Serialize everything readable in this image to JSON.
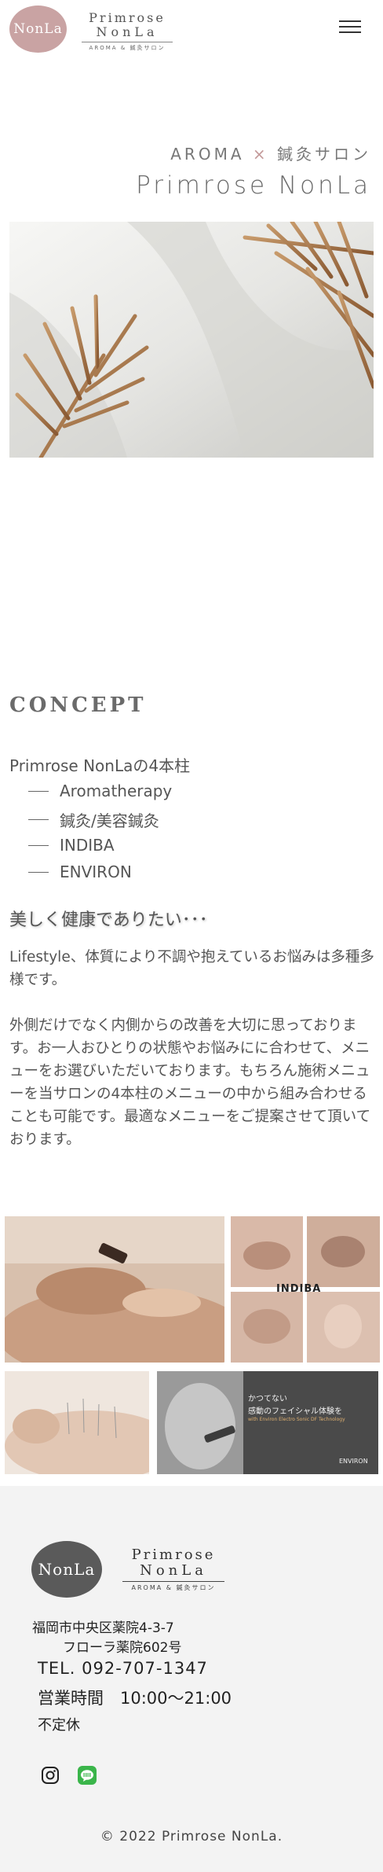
{
  "header": {
    "logo_circle_text": "NonLa",
    "logo_line1": "Primrose",
    "logo_line2": "NonLa",
    "logo_line3": "AROMA & 鍼灸サロン"
  },
  "hero": {
    "subtitle_left": "AROMA",
    "subtitle_x": "×",
    "subtitle_right": "鍼灸サロン",
    "title": "Primrose NonLa"
  },
  "concept": {
    "heading": "CONCEPT",
    "pillars_title": "Primrose NonLaの4本柱",
    "pillars": [
      "Aromatherapy",
      "鍼灸/美容鍼灸",
      "INDIBA",
      "ENVIRON"
    ],
    "lead": "美しく健康でありたい･･･",
    "paragraph1": "Lifestyle、体質により不調や抱えているお悩みは多種多様です。",
    "paragraph2": "外側だけでなく内側からの改善を大切に思っております。お一人おひとりの状態やお悩みにに合わせて、メニューをお選びいただいております。もちろん施術メニューを当サロンの4本柱のメニューの中から組み合わせることも可能です。最適なメニューをご提案させて頂いております。"
  },
  "photos": {
    "indiba_label": "INDIBA",
    "environ_caption1": "かつてない",
    "environ_caption2": "感動のフェイシャル体験を",
    "environ_caption3": "with Environ Electro Sonic DF Technology",
    "environ_brand": "ENVIRON"
  },
  "footer": {
    "logo_circle_text": "NonLa",
    "logo_line1": "Primrose",
    "logo_line2": "NonLa",
    "logo_line3": "AROMA & 鍼灸サロン",
    "address1": "福岡市中央区薬院4-3-7",
    "address2": "フローラ薬院602号",
    "tel": "TEL. 092-707-1347",
    "hours": "営業時間　10:00～21:00",
    "closed": "不定休",
    "copyright": "© 2022 Primrose  NonLa."
  },
  "colors": {
    "accent_pink": "#c9a3a3",
    "line_green": "#3ab54a"
  }
}
